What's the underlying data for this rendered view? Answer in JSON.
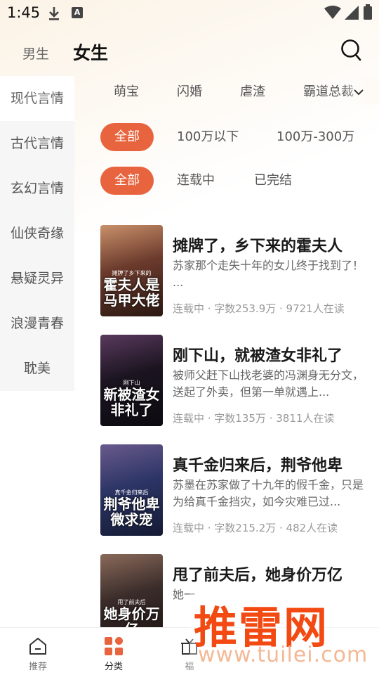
{
  "status_bar": {
    "time": "1:45",
    "icons": [
      "download-icon",
      "a-box-icon",
      "wifi-icon",
      "signal-icon",
      "battery-icon"
    ]
  },
  "header": {
    "tabs": [
      {
        "label": "男生",
        "active": false
      },
      {
        "label": "女生",
        "active": true
      }
    ],
    "search_icon": "search-icon"
  },
  "sidebar": {
    "items": [
      {
        "label": "现代言情",
        "active": false
      },
      {
        "label": "古代言情",
        "active": false
      },
      {
        "label": "玄幻言情",
        "active": false
      },
      {
        "label": "仙侠奇缘",
        "active": false
      },
      {
        "label": "悬疑灵异",
        "active": false
      },
      {
        "label": "浪漫青春",
        "active": false
      },
      {
        "label": "耽美",
        "active": false
      }
    ]
  },
  "subcategories": {
    "items": [
      "萌宝",
      "闪婚",
      "虐渣",
      "霸道总裁"
    ],
    "expand_icon": "chevron-down-icon"
  },
  "filters": {
    "word_count": [
      {
        "label": "全部",
        "active": true
      },
      {
        "label": "100万以下",
        "active": false
      },
      {
        "label": "100万-300万",
        "active": false
      }
    ],
    "status": [
      {
        "label": "全部",
        "active": true
      },
      {
        "label": "连载中",
        "active": false
      },
      {
        "label": "已完结",
        "active": false
      }
    ]
  },
  "books": [
    {
      "title": "摊牌了，乡下来的霍夫人",
      "desc": "苏家那个走失十年的女儿终于找到了！ ...",
      "meta": "连载中 · 字数253.9万 · 9721人在读",
      "cover_title": "霍夫人是马甲大佬",
      "cover_tag": "摊牌了乡下来的",
      "cover_colors": [
        "#6b3a2c",
        "#c9906a",
        "#2b1812"
      ]
    },
    {
      "title": "刚下山，就被渣女非礼了",
      "desc": "被师父赶下山找老婆的冯渊身无分文，送起了外卖，但第一单就遇上...",
      "meta": "连载中 · 字数135万 · 3811人在读",
      "cover_title": "新被渣女非礼了",
      "cover_tag": "刚下山",
      "cover_colors": [
        "#1b1420",
        "#5a3a5e",
        "#0c0a10"
      ]
    },
    {
      "title": "真千金归来后，荆爷他卑",
      "desc": "苏墨在苏家做了十九年的假千金，只是为给真千金挡灾，如今灾难已过...",
      "meta": "连载中 · 字数215.2万 · 482人在读",
      "cover_title": "荆爷他卑微求宠",
      "cover_tag": "真千金归来后",
      "cover_colors": [
        "#2c3566",
        "#6a5a8c",
        "#141a33"
      ]
    },
    {
      "title": "甩了前夫后，她身价万亿",
      "desc": "她一",
      "meta": "",
      "cover_title": "她身价万亿",
      "cover_tag": "甩了前夫后",
      "cover_colors": [
        "#3a2c2a",
        "#8a6a5a",
        "#1a1210"
      ]
    }
  ],
  "bottom_nav": [
    {
      "label": "推荐",
      "icon": "home-icon",
      "active": false
    },
    {
      "label": "分类",
      "icon": "category-grid-icon",
      "active": true
    },
    {
      "label": "福",
      "icon": "gift-icon",
      "active": false
    }
  ],
  "watermark": {
    "logo": "推雷网",
    "url": "www.tuilei.com"
  },
  "colors": {
    "accent": "#e8643f",
    "sidebar_bg": "#f6f6f6",
    "watermark_red": "#f24a12"
  }
}
